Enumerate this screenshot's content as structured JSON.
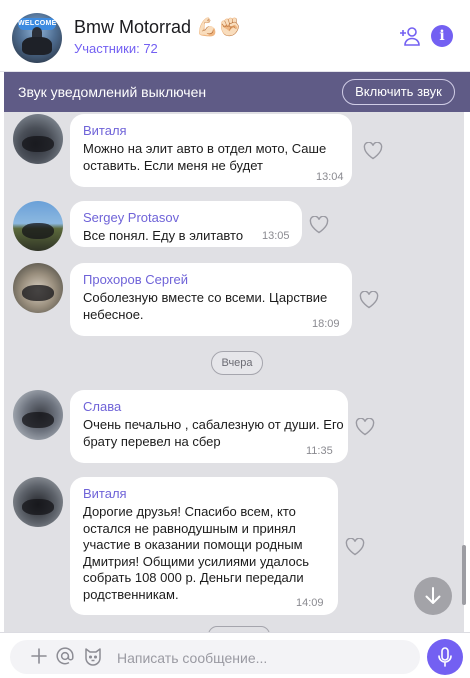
{
  "header": {
    "title": "Bmw Motorrad 💪🏻✊🏻",
    "subtitle": "Участники: 72",
    "avatar_badge": "WELCOME",
    "icons": [
      "add-member-icon",
      "info-icon"
    ],
    "info_glyph": "i"
  },
  "notice": {
    "text": "Звук уведомлений выключен",
    "button": "Включить звук"
  },
  "messages": [
    {
      "sender": "Виталя",
      "text": "Можно на элит авто в отдел мото, Саше оставить. Если меня не будет",
      "time": "13:04"
    },
    {
      "sender": "Sergey Protasov",
      "text": "Все понял. Еду в элитавто",
      "time": "13:05"
    },
    {
      "sender": "Прохоров Сергей",
      "text": "Соболезную вместе со всеми. Царствие небесное.",
      "time": "18:09"
    },
    {
      "sender": "Слава",
      "text": "Очень печально , сабалезную от души. Его брату перевел на сбер",
      "time": "11:35"
    },
    {
      "sender": "Виталя",
      "text": "Дорогие друзья! Спасибо всем, кто остался не равнодушным и принял участие в оказании помощи родным Дмитрия! Общими усилиями удалось собрать 108 000 р. Деньги передали родственникам.",
      "time": "14:09"
    }
  ],
  "day_separator": "Вчера",
  "composer": {
    "placeholder": "Написать сообщение...",
    "icons": [
      "plus-icon",
      "at-icon",
      "sticker-icon",
      "mic-icon"
    ]
  },
  "colors": {
    "accent": "#7360f2",
    "notice_bg": "#5f5b86",
    "chat_bg": "#e0e0e4",
    "sender": "#6f63d8"
  }
}
